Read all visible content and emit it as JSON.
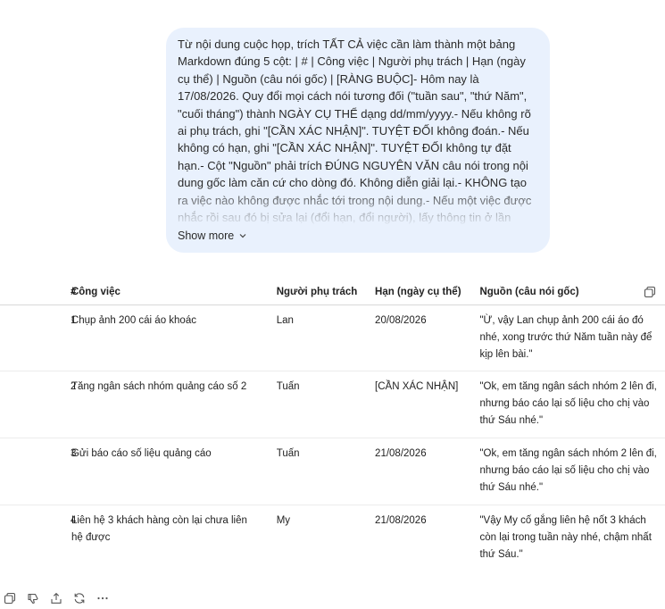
{
  "prompt": {
    "text": "Từ nội dung cuộc họp, trích TẤT CẢ việc cần làm thành một bảng Markdown đúng 5 cột: | # | Công việc | Người phụ trách | Hạn (ngày cụ thể) | Nguồn (câu nói  gốc) | [RÀNG BUỘC]- Hôm nay là 17/08/2026. Quy đổi mọi cách nói tương đối (\"tuần sau\",   \"thứ Năm\", \"cuối tháng\") thành NGÀY CỤ THỂ dạng dd/mm/yyyy.- Nếu không rõ ai phụ trách, ghi \"[CẦN XÁC NHẬN]\". TUYỆT ĐỐI không đoán.- Nếu không có hạn, ghi \"[CẦN XÁC NHẬN]\". TUYỆT ĐỐI không tự đặt hạn.- Cột \"Nguồn\" phải trích ĐÚNG NGUYÊN VĂN câu nói trong nội dung gốc   làm căn cứ cho dòng đó. Không diễn giải lại.- KHÔNG tạo ra việc nào không được nhắc tới trong nội dung.- Nếu một việc được nhắc rồi sau đó bị sửa lại (đổi hạn, đổi người),   lấy thông tin ở lần nhắc SAU CÙNG và ghi chú \"",
    "show_more_label": "Show more"
  },
  "table": {
    "headers": [
      "#",
      "Công việc",
      "Người phụ trách",
      "Hạn (ngày cụ thể)",
      "Nguồn (câu nói gốc)"
    ],
    "rows": [
      [
        "1",
        "Chụp ảnh 200 cái áo khoác",
        "Lan",
        "20/08/2026",
        "\"Ừ, vậy Lan chụp ảnh 200 cái áo đó nhé, xong trước thứ Năm tuần này để kịp lên bài.\""
      ],
      [
        "2",
        "Tăng ngân sách nhóm quảng cáo số 2",
        "Tuấn",
        "[CẦN XÁC NHẬN]",
        "\"Ok, em tăng ngân sách nhóm 2 lên đi, nhưng báo cáo lại số liệu cho chị vào thứ Sáu nhé.\""
      ],
      [
        "3",
        "Gửi báo cáo số liệu quảng cáo",
        "Tuấn",
        "21/08/2026",
        "\"Ok, em tăng ngân sách nhóm 2 lên đi, nhưng báo cáo lại số liệu cho chị vào thứ Sáu nhé.\""
      ],
      [
        "4",
        "Liên hệ 3 khách hàng còn lại chưa liên hệ được",
        "My",
        "21/08/2026",
        "\"Vậy My cố gắng liên hệ nốt 3 khách còn lại trong tuần này nhé, chậm nhất thứ Sáu.\""
      ]
    ]
  },
  "icons": {
    "copy_table": "copy-icon",
    "toolbar": [
      "copy-icon",
      "thumbs-down-icon",
      "share-icon",
      "regenerate-icon",
      "more-icon"
    ]
  },
  "colors": {
    "bubble_bg": "#e9f1fd",
    "text": "#1f1f1f",
    "divider": "#ececec"
  }
}
